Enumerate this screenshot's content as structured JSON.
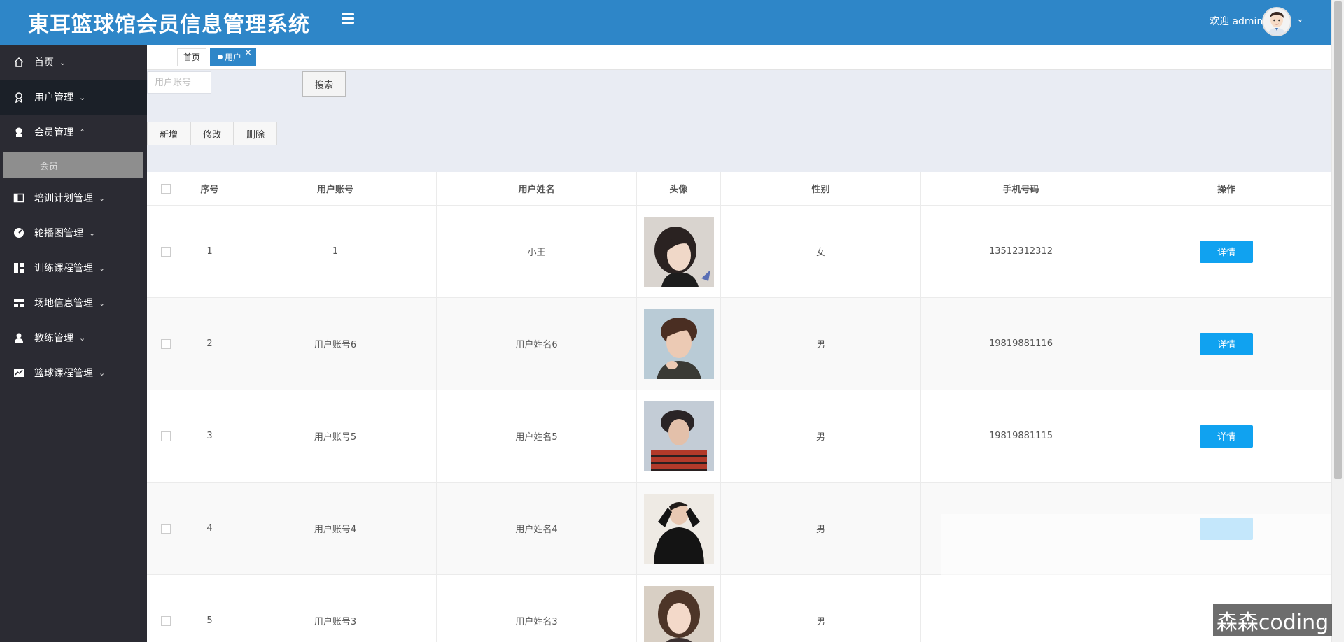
{
  "header": {
    "title": "東耳篮球馆会员信息管理系统",
    "welcome": "欢迎 admin",
    "caret": "⌄"
  },
  "sidebar": {
    "items": [
      {
        "label": "首页",
        "icon": "home-icon",
        "caret": "⌄"
      },
      {
        "label": "用户管理",
        "icon": "user-badge-icon",
        "caret": "⌄"
      },
      {
        "label": "会员管理",
        "icon": "member-icon",
        "caret": "⌃"
      },
      {
        "label": "培训计划管理",
        "icon": "book-icon",
        "caret": "⌄"
      },
      {
        "label": "轮播图管理",
        "icon": "dashboard-icon",
        "caret": "⌄"
      },
      {
        "label": "训练课程管理",
        "icon": "grid-icon",
        "caret": "⌄"
      },
      {
        "label": "场地信息管理",
        "icon": "layout-icon",
        "caret": "⌄"
      },
      {
        "label": "教练管理",
        "icon": "person-icon",
        "caret": "⌄"
      },
      {
        "label": "篮球课程管理",
        "icon": "chart-icon",
        "caret": "⌄"
      }
    ],
    "sub_items": {
      "member": "会员"
    }
  },
  "tabs": {
    "home": "首页",
    "user": "用户",
    "close": "×"
  },
  "search": {
    "placeholder": "用户账号",
    "button": "搜索"
  },
  "toolbar": {
    "add": "新增",
    "edit": "修改",
    "delete": "删除"
  },
  "table": {
    "columns": [
      "序号",
      "用户账号",
      "用户姓名",
      "头像",
      "性别",
      "手机号码",
      "操作"
    ],
    "rows": [
      {
        "no": "1",
        "account": "1",
        "name": "小王",
        "gender": "女",
        "phone": "13512312312",
        "action": "详情"
      },
      {
        "no": "2",
        "account": "用户账号6",
        "name": "用户姓名6",
        "gender": "男",
        "phone": "19819881116",
        "action": "详情"
      },
      {
        "no": "3",
        "account": "用户账号5",
        "name": "用户姓名5",
        "gender": "男",
        "phone": "19819881115",
        "action": "详情"
      },
      {
        "no": "4",
        "account": "用户账号4",
        "name": "用户姓名4",
        "gender": "男",
        "phone": "",
        "action": ""
      },
      {
        "no": "5",
        "account": "用户账号3",
        "name": "用户姓名3",
        "gender": "男",
        "phone": "",
        "action": ""
      }
    ]
  },
  "watermark": "森森coding",
  "colors": {
    "header": "#2e86c8",
    "sidebar": "#2b2b33",
    "accent_button": "#10a2f0",
    "content_bg": "#e9ecf3"
  }
}
